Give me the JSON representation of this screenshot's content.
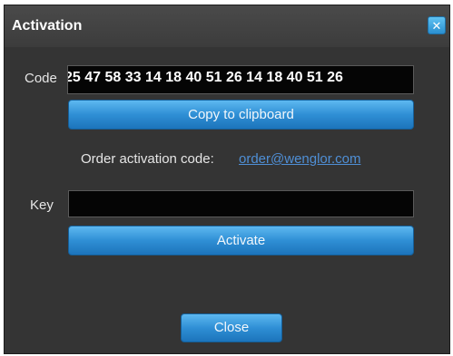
{
  "dialog": {
    "title": "Activation",
    "close_glyph": "✕"
  },
  "code": {
    "label": "Code",
    "value": "25 47 58 33 14 18 40 51 26 14 18 40 51 26"
  },
  "copy_button": {
    "label": "Copy to clipboard"
  },
  "order": {
    "label": "Order activation code:",
    "link": "order@wenglor.com"
  },
  "key": {
    "label": "Key",
    "value": ""
  },
  "activate_button": {
    "label": "Activate"
  },
  "close_button": {
    "label": "Close"
  }
}
